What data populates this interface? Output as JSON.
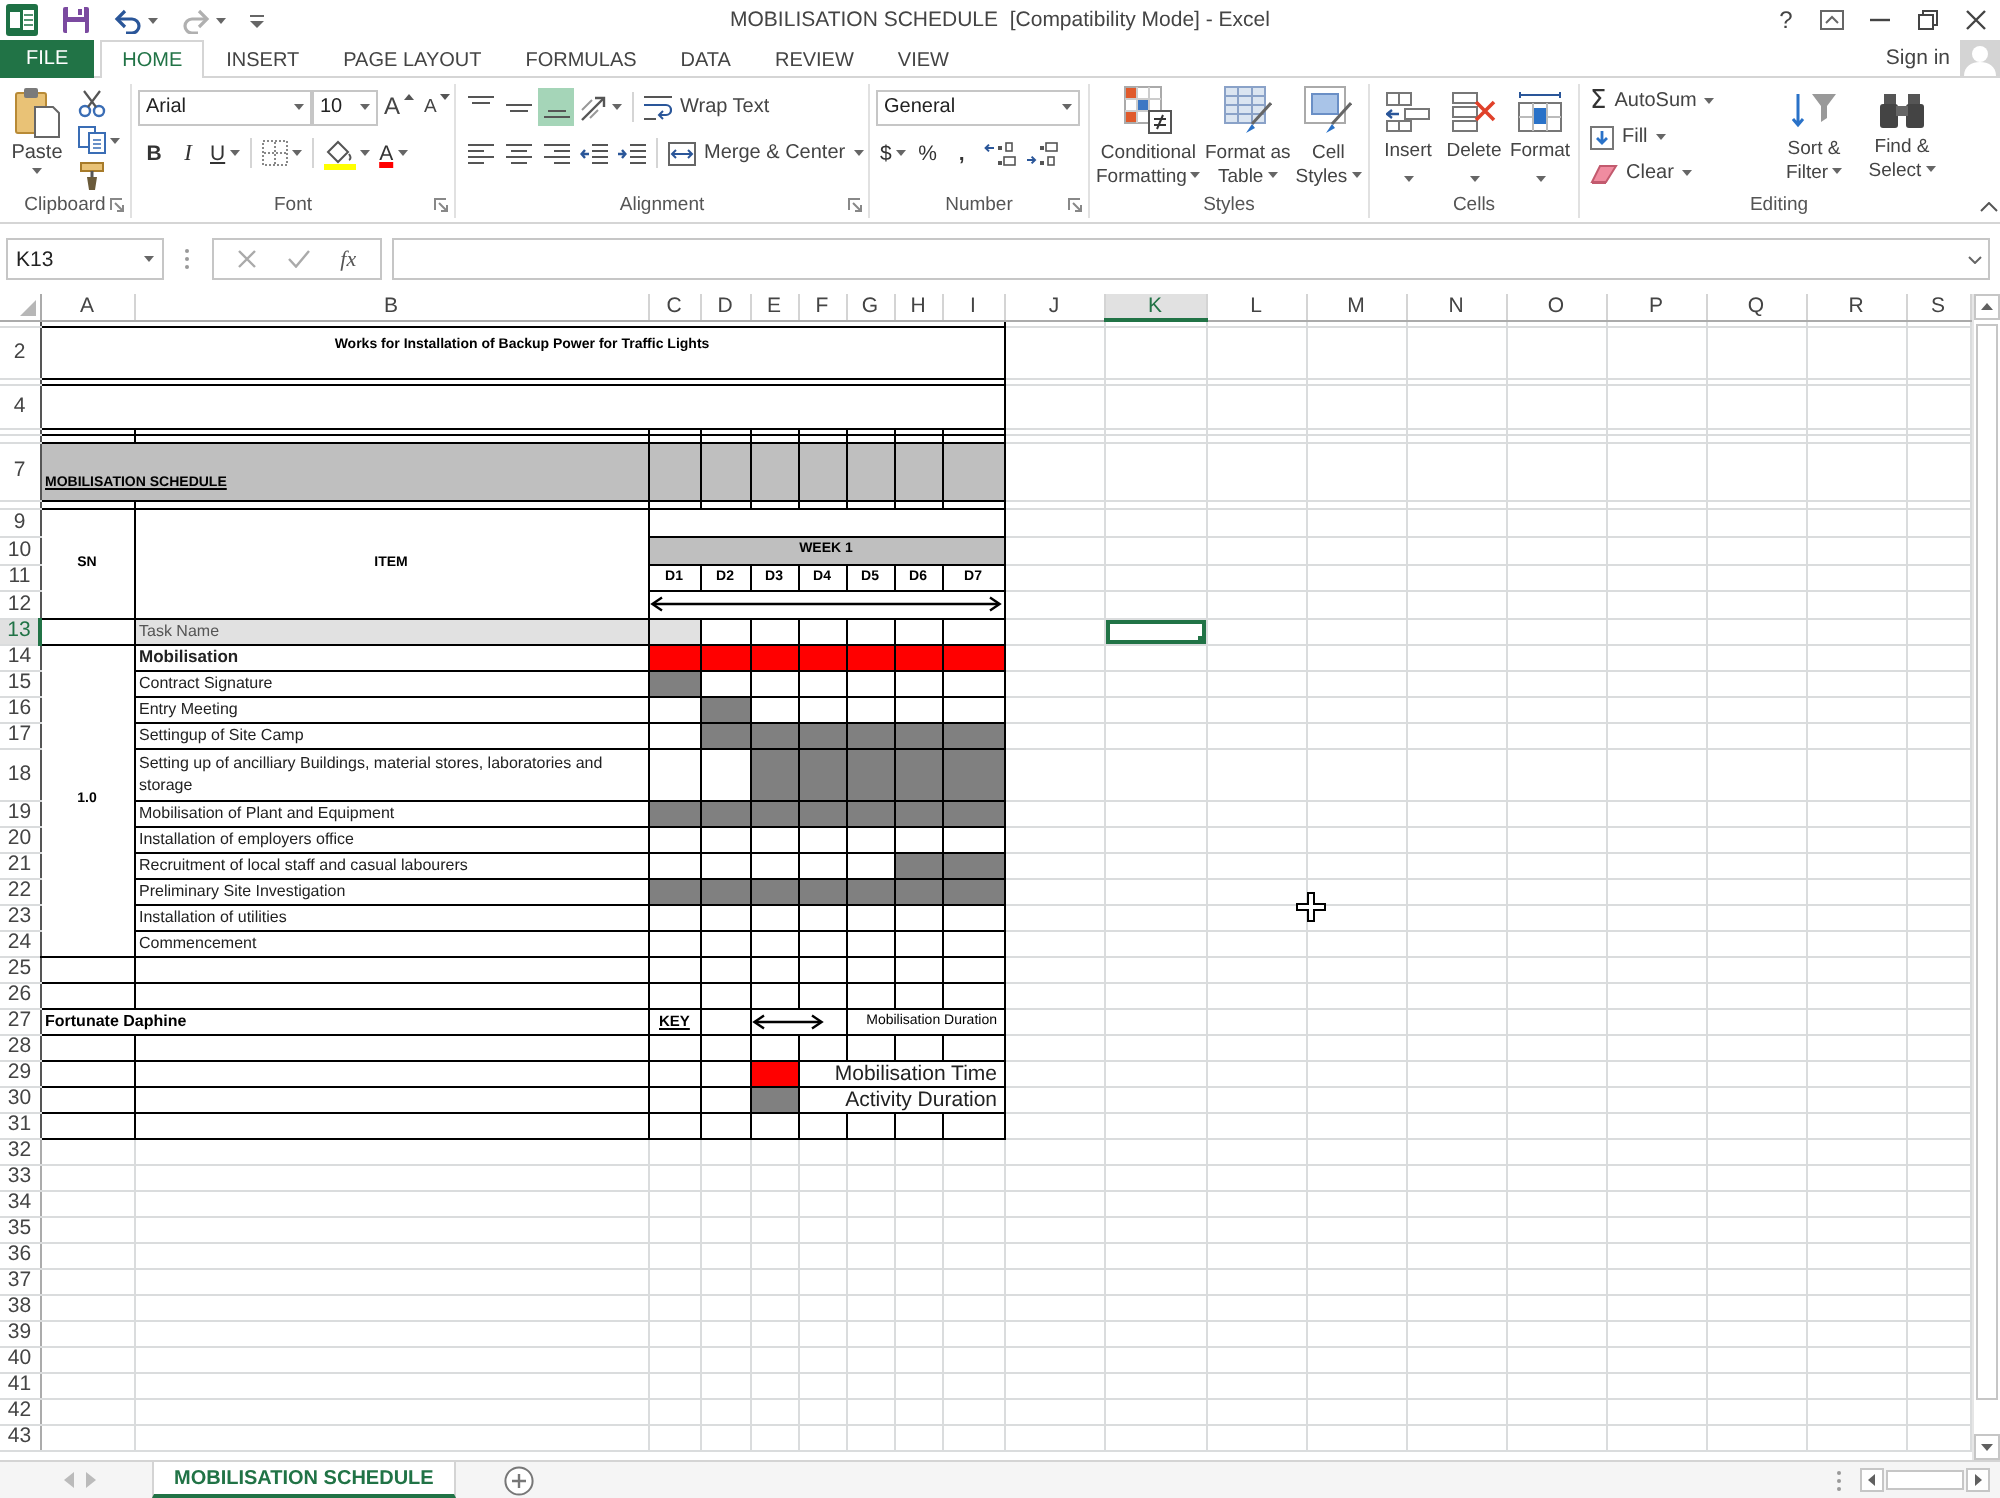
{
  "window": {
    "title": "MOBILISATION SCHEDULE  [Compatibility Mode] - Excel",
    "help": "?"
  },
  "ribbon_tabs": [
    {
      "label": "FILE",
      "kind": "file",
      "selected": false
    },
    {
      "label": "HOME",
      "kind": "tab",
      "selected": true
    },
    {
      "label": "INSERT",
      "kind": "tab",
      "selected": false
    },
    {
      "label": "PAGE LAYOUT",
      "kind": "tab",
      "selected": false
    },
    {
      "label": "FORMULAS",
      "kind": "tab",
      "selected": false
    },
    {
      "label": "DATA",
      "kind": "tab",
      "selected": false
    },
    {
      "label": "REVIEW",
      "kind": "tab",
      "selected": false
    },
    {
      "label": "VIEW",
      "kind": "tab",
      "selected": false
    }
  ],
  "account": {
    "label": "Sign in"
  },
  "ribbon": {
    "clipboard": {
      "label": "Clipboard",
      "paste": "Paste"
    },
    "font": {
      "label": "Font",
      "font_name": "Arial",
      "font_size": "10",
      "grow": "A",
      "shrink": "A",
      "bold": "B",
      "italic": "I",
      "underline": "U",
      "font_color": "A"
    },
    "alignment": {
      "label": "Alignment",
      "vertical": [
        {
          "kind": "top",
          "selected": false
        },
        {
          "kind": "middle",
          "selected": false
        },
        {
          "kind": "bottom",
          "selected": true
        }
      ],
      "horizontal": [
        {
          "kind": "left",
          "selected": false
        },
        {
          "kind": "center",
          "selected": false
        },
        {
          "kind": "right",
          "selected": false
        }
      ],
      "wrap_text": "Wrap Text",
      "merge": "Merge & Center"
    },
    "number": {
      "label": "Number",
      "format": "General",
      "currency": "$",
      "percent": "%",
      "comma": ","
    },
    "styles": {
      "label": "Styles",
      "buttons": [
        {
          "kind": "conditional",
          "label": "Conditional Formatting"
        },
        {
          "kind": "table",
          "label": "Format as Table"
        },
        {
          "kind": "cell",
          "label": "Cell Styles"
        }
      ]
    },
    "cells": {
      "label": "Cells",
      "buttons": [
        {
          "kind": "insert",
          "label": "Insert"
        },
        {
          "kind": "delete",
          "label": "Delete"
        },
        {
          "kind": "format",
          "label": "Format"
        }
      ]
    },
    "editing": {
      "label": "Editing",
      "sum_icon": "Σ",
      "small": [
        {
          "kind": "autosum",
          "label": "AutoSum"
        },
        {
          "kind": "fill",
          "label": "Fill"
        },
        {
          "kind": "clear",
          "label": "Clear"
        }
      ],
      "buttons": [
        {
          "kind": "sort",
          "label": "Sort & Filter"
        },
        {
          "kind": "find",
          "label": "Find & Select"
        }
      ]
    }
  },
  "formula_bar": {
    "name_box": "K13",
    "function": "fx"
  },
  "columns": [
    {
      "label": "A",
      "selected": false
    },
    {
      "label": "B",
      "selected": false
    },
    {
      "label": "C",
      "selected": false
    },
    {
      "label": "D",
      "selected": false
    },
    {
      "label": "E",
      "selected": false
    },
    {
      "label": "F",
      "selected": false
    },
    {
      "label": "G",
      "selected": false
    },
    {
      "label": "H",
      "selected": false
    },
    {
      "label": "I",
      "selected": false
    },
    {
      "label": "J",
      "selected": false
    },
    {
      "label": "K",
      "selected": true
    },
    {
      "label": "L",
      "selected": false
    },
    {
      "label": "M",
      "selected": false
    },
    {
      "label": "N",
      "selected": false
    },
    {
      "label": "O",
      "selected": false
    },
    {
      "label": "P",
      "selected": false
    },
    {
      "label": "Q",
      "selected": false
    },
    {
      "label": "R",
      "selected": false
    },
    {
      "label": "S",
      "selected": false
    }
  ],
  "rows": [
    {
      "label": "2",
      "selected": false
    },
    {
      "label": "4",
      "selected": false
    },
    {
      "label": "7",
      "selected": false
    },
    {
      "label": "9",
      "selected": false
    },
    {
      "label": "10",
      "selected": false
    },
    {
      "label": "11",
      "selected": false
    },
    {
      "label": "12",
      "selected": false
    },
    {
      "label": "13",
      "selected": true
    },
    {
      "label": "14",
      "selected": false
    },
    {
      "label": "15",
      "selected": false
    },
    {
      "label": "16",
      "selected": false
    },
    {
      "label": "17",
      "selected": false
    },
    {
      "label": "18",
      "selected": false
    },
    {
      "label": "19",
      "selected": false
    },
    {
      "label": "20",
      "selected": false
    },
    {
      "label": "21",
      "selected": false
    },
    {
      "label": "22",
      "selected": false
    },
    {
      "label": "23",
      "selected": false
    },
    {
      "label": "24",
      "selected": false
    },
    {
      "label": "25",
      "selected": false
    },
    {
      "label": "26",
      "selected": false
    },
    {
      "label": "27",
      "selected": false
    },
    {
      "label": "28",
      "selected": false
    },
    {
      "label": "29",
      "selected": false
    },
    {
      "label": "30",
      "selected": false
    },
    {
      "label": "31",
      "selected": false
    },
    {
      "label": "32",
      "selected": false
    },
    {
      "label": "33",
      "selected": false
    },
    {
      "label": "34",
      "selected": false
    },
    {
      "label": "35",
      "selected": false
    },
    {
      "label": "36",
      "selected": false
    },
    {
      "label": "37",
      "selected": false
    },
    {
      "label": "38",
      "selected": false
    },
    {
      "label": "39",
      "selected": false
    },
    {
      "label": "40",
      "selected": false
    },
    {
      "label": "41",
      "selected": false
    },
    {
      "label": "42",
      "selected": false
    },
    {
      "label": "43",
      "selected": false
    }
  ],
  "sheet": {
    "title": "Works for Installation of Backup Power for Traffic Lights",
    "section": "MOBILISATION SCHEDULE",
    "sn_header": "SN",
    "item_header": "ITEM",
    "week": "WEEK 1",
    "days": [
      "D1",
      "D2",
      "D3",
      "D4",
      "D5",
      "D6",
      "D7"
    ],
    "task_header": "Task Name",
    "sn": "1.0",
    "tasks": [
      {
        "name": "Mobilisation",
        "kind": "summary",
        "color": "#ff0000",
        "days": [
          true,
          true,
          true,
          true,
          true,
          true,
          true
        ]
      },
      {
        "name": "Contract Signature",
        "kind": "activity",
        "color": "#808080",
        "days": [
          true,
          false,
          false,
          false,
          false,
          false,
          false
        ]
      },
      {
        "name": "Entry Meeting",
        "kind": "activity",
        "color": "#808080",
        "days": [
          false,
          true,
          false,
          false,
          false,
          false,
          false
        ]
      },
      {
        "name": "Settingup of Site Camp",
        "kind": "activity",
        "color": "#808080",
        "days": [
          false,
          true,
          true,
          true,
          true,
          true,
          true
        ]
      },
      {
        "name": "Setting up of ancilliary Buildings, material stores, laboratories and storage",
        "kind": "activity",
        "color": "#808080",
        "days": [
          false,
          false,
          true,
          true,
          true,
          true,
          true
        ]
      },
      {
        "name": "Mobilisation of Plant and Equipment",
        "kind": "activity",
        "color": "#808080",
        "days": [
          true,
          true,
          true,
          true,
          true,
          true,
          true
        ]
      },
      {
        "name": "Installation of employers office",
        "kind": "activity",
        "days": [
          false,
          false,
          false,
          false,
          false,
          false,
          false
        ]
      },
      {
        "name": "Recruitment of local staff and casual labourers",
        "kind": "activity",
        "color": "#808080",
        "days": [
          false,
          false,
          false,
          false,
          false,
          true,
          true
        ]
      },
      {
        "name": "Preliminary Site Investigation",
        "kind": "activity",
        "color": "#808080",
        "days": [
          true,
          true,
          true,
          true,
          true,
          true,
          true
        ]
      },
      {
        "name": "Installation of utilities",
        "kind": "activity",
        "days": [
          false,
          false,
          false,
          false,
          false,
          false,
          false
        ]
      },
      {
        "name": "Commencement",
        "kind": "activity",
        "days": [
          false,
          false,
          false,
          false,
          false,
          false,
          false
        ]
      }
    ],
    "author": "Fortunate Daphine",
    "key": {
      "label": "KEY",
      "items": [
        {
          "kind": "arrow",
          "label": "Mobilisation Duration"
        },
        {
          "kind": "swatch",
          "color": "#ff0000",
          "label": "Mobilisation Time"
        },
        {
          "kind": "swatch",
          "color": "#808080",
          "label": "Activity Duration"
        }
      ]
    }
  },
  "sheet_tabs": [
    {
      "label": "MOBILISATION SCHEDULE",
      "selected": true
    }
  ]
}
